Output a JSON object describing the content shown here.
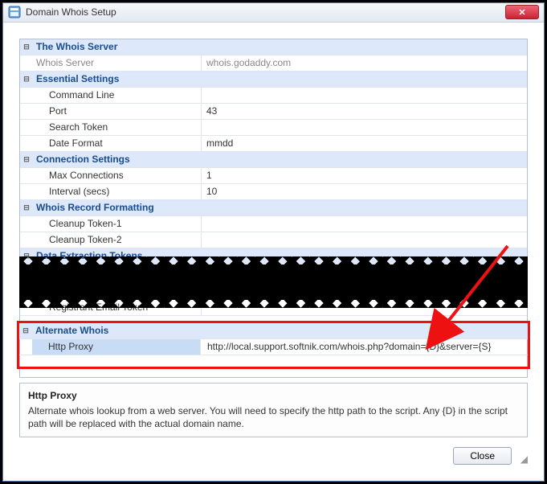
{
  "window": {
    "title": "Domain Whois Setup"
  },
  "sections": {
    "whois_server": {
      "title": "The Whois Server",
      "rows": {
        "server_label": "Whois Server",
        "server_value": "whois.godaddy.com"
      }
    },
    "essential": {
      "title": "Essential Settings",
      "rows": {
        "cmdline_label": "Command Line",
        "cmdline_value": "",
        "port_label": "Port",
        "port_value": "43",
        "token_label": "Search Token",
        "token_value": "",
        "datefmt_label": "Date Format",
        "datefmt_value": "mmdd"
      }
    },
    "connection": {
      "title": "Connection Settings",
      "rows": {
        "maxconn_label": "Max Connections",
        "maxconn_value": "1",
        "interval_label": "Interval (secs)",
        "interval_value": "10"
      }
    },
    "formatting": {
      "title": "Whois Record Formatting",
      "rows": {
        "ct1_label": "Cleanup Token-1",
        "ct1_value": "",
        "ct2_label": "Cleanup Token-2",
        "ct2_value": ""
      }
    },
    "extraction": {
      "title": "Data Extraction Tokens",
      "rows": {
        "regemail_label": "Registrant Email Token",
        "regemail_value": ""
      }
    },
    "alternate": {
      "title": "Alternate Whois",
      "rows": {
        "proxy_label": "Http Proxy",
        "proxy_value": "http://local.support.softnik.com/whois.php?domain={D}&server={S}"
      }
    }
  },
  "help": {
    "title": "Http Proxy",
    "text": "Alternate whois lookup from a web server. You will need to specify the http path to the script. Any {D} in the script path will be replaced with the actual domain name."
  },
  "buttons": {
    "close": "Close"
  },
  "icons": {
    "expander": "⊟"
  }
}
